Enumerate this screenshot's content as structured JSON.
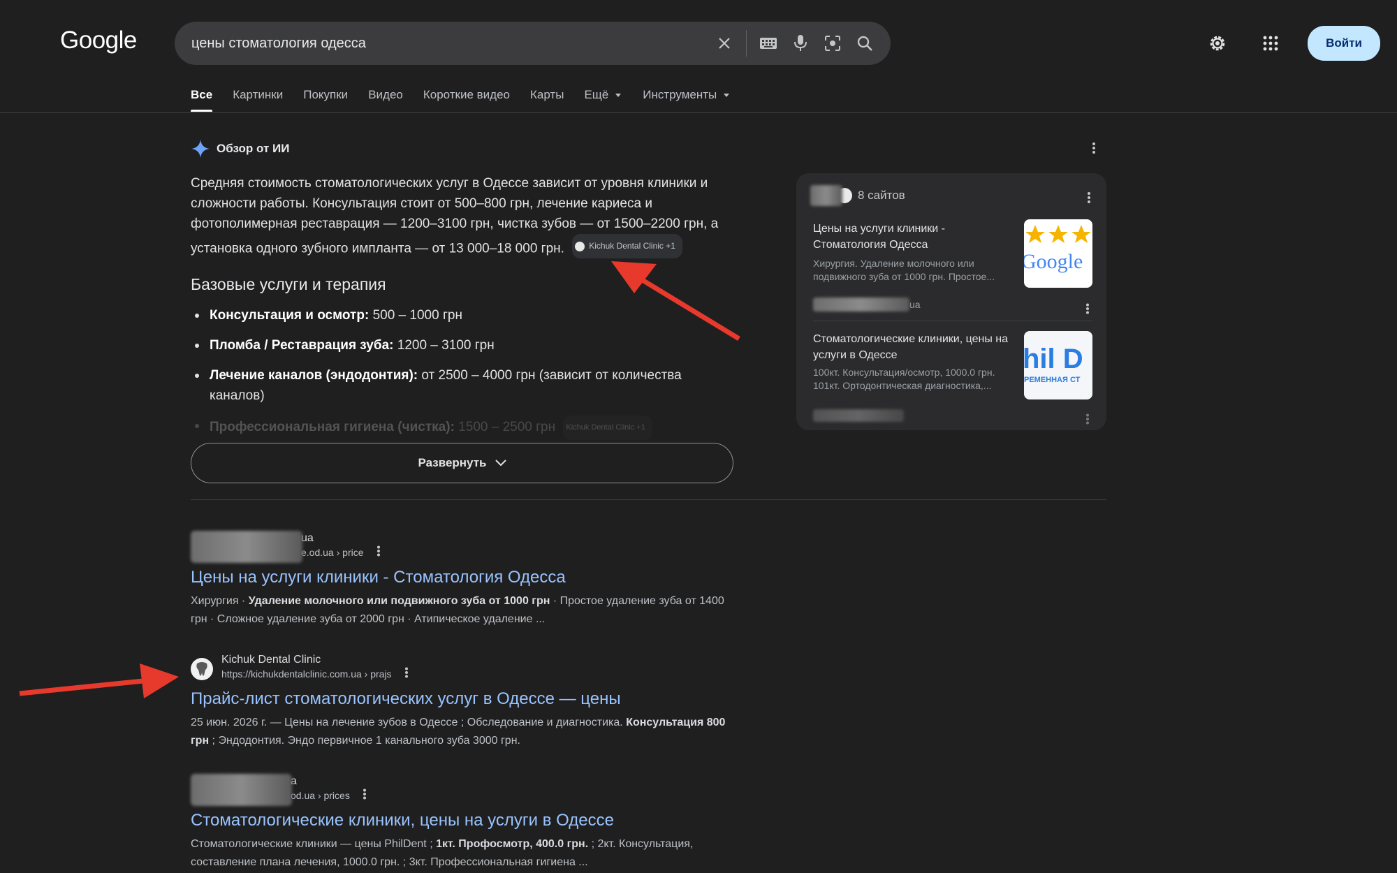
{
  "header": {
    "logo": "Google",
    "query": "цены стоматология одесса",
    "signin": "Войти"
  },
  "tabs": [
    {
      "label": "Все"
    },
    {
      "label": "Картинки"
    },
    {
      "label": "Покупки"
    },
    {
      "label": "Видео"
    },
    {
      "label": "Короткие видео"
    },
    {
      "label": "Карты"
    },
    {
      "label": "Ещё"
    },
    {
      "label": "Инструменты"
    }
  ],
  "ai": {
    "heading": "Обзор от ИИ",
    "paragraph": "Средняя стоимость стоматологических услуг в Одессе зависит от уровня клиники и сложности работы. Консультация стоит от 500–800 грн, лечение кариеса и фотополимерная реставрация — 1200–3100 грн, чистка зубов — от 1500–2200 грн, а установка одного зубного импланта — от 13 000–18 000 грн.",
    "chip": "Kichuk Dental Clinic +1",
    "subheading": "Базовые услуги и терапия",
    "items": [
      {
        "bold": "Консультация и осмотр:",
        "text": " 500 – 1000 грн"
      },
      {
        "bold": "Пломба / Реставрация зуба:",
        "text": " 1200 – 3100 грн"
      },
      {
        "bold": "Лечение каналов (эндодонтия):",
        "text": " от 2500 – 4000 грн (зависит от количества каналов)"
      },
      {
        "bold": "Профессиональная гигиена (чистка):",
        "text": " 1500 – 2500 грн"
      }
    ],
    "faded_chip": "Kichuk Dental Clinic +1",
    "expand": "Развернуть"
  },
  "panel": {
    "count": "8 сайтов",
    "sources": [
      {
        "title": "Цены на услуги клиники - Стоматология Одесса",
        "desc": "Хирургия. Удаление молочного или подвижного зуба от 1000 грн. Простое...",
        "domain": "ua",
        "thumb_text": "Google"
      },
      {
        "title": "Стоматологические клиники, цены на услуги в Одессе",
        "desc": "100кт. Консультация/осмотр, 1000.0 грн. 101кт. Ортодонтическая диагностика,...",
        "domain": "",
        "thumb_text_1": "hil D",
        "thumb_text_2": "РЕМЕННАЯ СТ"
      }
    ]
  },
  "results": [
    {
      "site": "ua",
      "url": "e.od.ua › price",
      "title": "Цены на услуги клиники - Стоматология Одесса",
      "snippet_pre": "Хирургия · ",
      "snippet_bold": "Удаление молочного или подвижного зуба от 1000 грн",
      "snippet_post": " · Простое удаление зуба от 1400 грн · Сложное удаление зуба от 2000 грн · Атипическое удаление ..."
    },
    {
      "site": "Kichuk Dental Clinic",
      "url": "https://kichukdentalclinic.com.ua › prajs",
      "title": "Прайс-лист стоматологических услуг в Одессе — цены",
      "snippet_pre": "25 июн. 2026 г. — Цены на лечение зубов в Одессе ; Обследование и диагностика. ",
      "snippet_bold": "Консультация 800 грн",
      "snippet_post": " ; Эндодонтия. Эндо первичное 1 канального зуба 3000 грн."
    },
    {
      "site": "a",
      "url": "od.ua › prices",
      "title": "Стоматологические клиники, цены на услуги в Одессе",
      "snippet_pre": "Стоматологические клиники — цены PhilDent ; ",
      "snippet_bold": "1кт. Профосмотр, 400.0 грн.",
      "snippet_post": " ; 2кт. Консультация, составление плана лечения, 1000.0 грн. ; 3кт. Профессиональная гигиена ..."
    }
  ],
  "colors": {
    "background": "#1f1f1f",
    "link": "#99c3ff",
    "annotation_arrow": "#e8392d",
    "signin_bg": "#c2e7ff"
  }
}
